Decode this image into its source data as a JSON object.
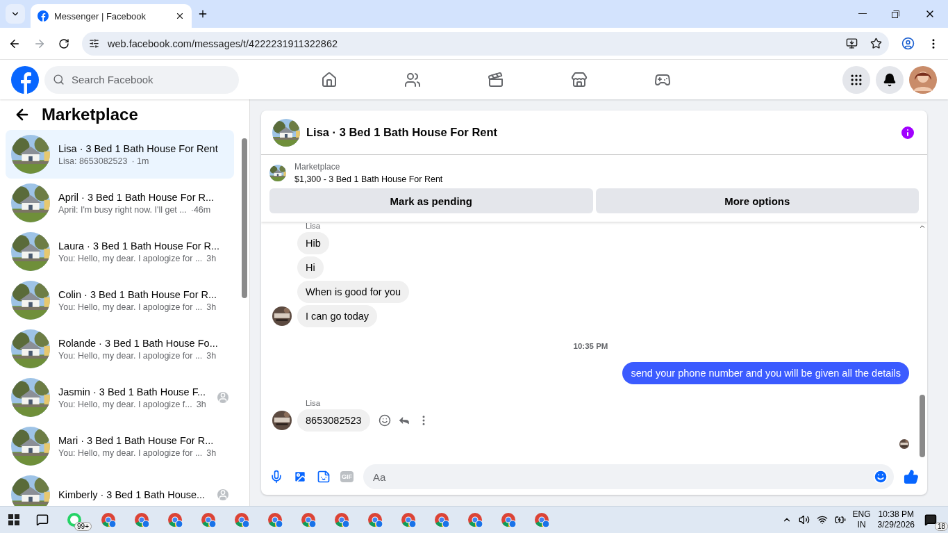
{
  "browser": {
    "tabs": [
      {
        "title": "Messenger | Facebook",
        "selected": true
      }
    ],
    "url": "web.facebook.com/messages/t/4222231911322862"
  },
  "topbar": {
    "search_placeholder": "Search Facebook"
  },
  "sidebar": {
    "title": "Marketplace",
    "conversations": [
      {
        "title": "Lisa · 3 Bed 1 Bath House For Rent",
        "preview": "Lisa: 8653082523",
        "time": "· 1m",
        "selected": true,
        "seen_avatar": false
      },
      {
        "title": "April · 3 Bed 1 Bath House For R...",
        "preview": "April: I'm busy right now. I'll get ...",
        "time": "·46m",
        "selected": false,
        "seen_avatar": false
      },
      {
        "title": "Laura · 3 Bed 1 Bath House For R...",
        "preview": "You: Hello, my dear. I apologize for ...",
        "time": "3h",
        "selected": false,
        "seen_avatar": false
      },
      {
        "title": "Colin · 3 Bed 1 Bath House For R...",
        "preview": "You: Hello, my dear. I apologize for ...",
        "time": "3h",
        "selected": false,
        "seen_avatar": false
      },
      {
        "title": "Rolande · 3 Bed 1 Bath House Fo...",
        "preview": "You: Hello, my dear. I apologize for ...",
        "time": "3h",
        "selected": false,
        "seen_avatar": false
      },
      {
        "title": "Jasmin · 3 Bed 1 Bath House F...",
        "preview": "You: Hello, my dear. I apologize f...",
        "time": "3h",
        "selected": false,
        "seen_avatar": true
      },
      {
        "title": "Mari · 3 Bed 1 Bath House For R...",
        "preview": "You: Hello, my dear. I apologize for ...",
        "time": "3h",
        "selected": false,
        "seen_avatar": false
      },
      {
        "title": "Kimberly · 3 Bed 1 Bath House...",
        "selected": false,
        "seen_avatar": true
      }
    ]
  },
  "chat": {
    "title": "Lisa · 3 Bed 1 Bath House For Rent",
    "listing_label": "Marketplace",
    "listing": "$1,300 - 3 Bed 1 Bath House For Rent",
    "buttons": [
      "Mark as pending",
      "More options"
    ],
    "messages": [
      {
        "kind": "sender",
        "text": "Lisa"
      },
      {
        "kind": "incoming",
        "text": "Hib",
        "avatar": false,
        "actions": false
      },
      {
        "kind": "incoming",
        "text": "Hi",
        "avatar": false,
        "actions": false
      },
      {
        "kind": "incoming",
        "text": "When is good for you",
        "avatar": false,
        "actions": false
      },
      {
        "kind": "incoming",
        "text": "I can go today",
        "avatar": true,
        "actions": false
      },
      {
        "kind": "timestamp",
        "text": "10:35 PM"
      },
      {
        "kind": "outgoing",
        "text": "send your phone number and you will be given all the details"
      },
      {
        "kind": "sender",
        "text": "Lisa"
      },
      {
        "kind": "incoming",
        "text": "8653082523",
        "avatar": true,
        "actions": true
      },
      {
        "kind": "seen"
      }
    ],
    "composer_placeholder": "Aa",
    "gif_label": "GIF"
  },
  "taskbar": {
    "whatsapp_badge": "99+",
    "time": "10:38 PM",
    "date": "3/29/2026",
    "language": "ENG",
    "region": "IN",
    "notifications": "18"
  }
}
